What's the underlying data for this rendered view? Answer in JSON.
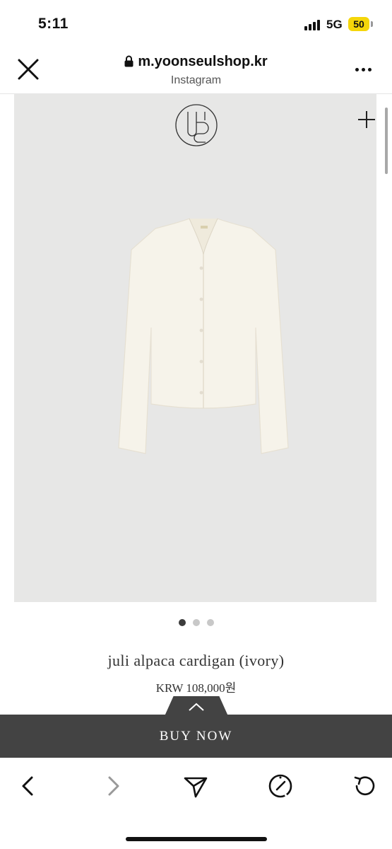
{
  "status_bar": {
    "time": "5:11",
    "network": "5G",
    "battery": "50",
    "battery_color": "#f5d60a"
  },
  "browser": {
    "url": "m.yoonseulshop.kr",
    "source": "Instagram"
  },
  "product": {
    "name": "juli alpaca cardigan (ivory)",
    "price": "KRW 108,000원",
    "image_background": "#e7e7e6",
    "garment_color": "#f6f3ea"
  },
  "carousel": {
    "total": 3,
    "active_index": 0
  },
  "cta": {
    "label": "BUY NOW",
    "color": "#434343"
  },
  "toolbar": {
    "icons": [
      "back-icon",
      "forward-icon",
      "share-icon",
      "compass-icon",
      "reload-icon"
    ]
  }
}
